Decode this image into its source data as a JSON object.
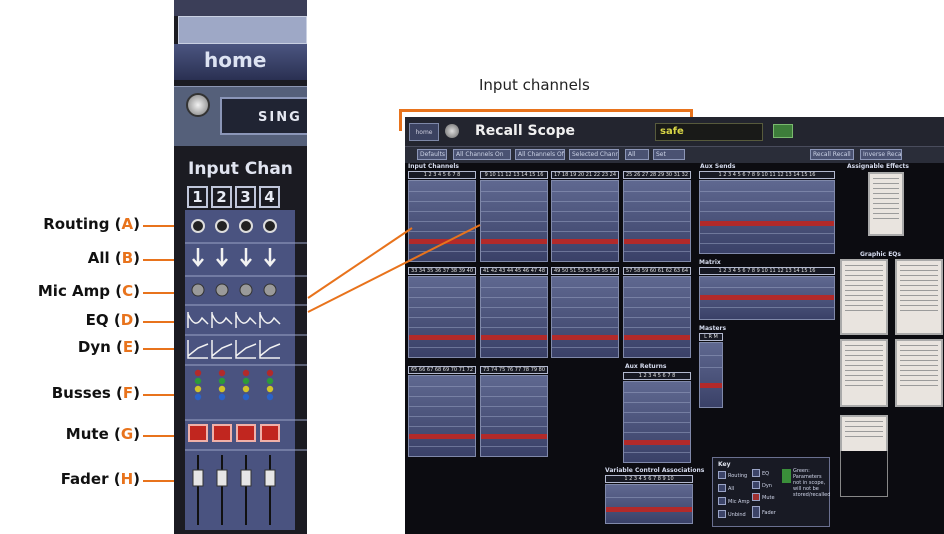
{
  "caption": "Input channels",
  "legend": [
    {
      "label": "Routing",
      "letter": "A"
    },
    {
      "label": "All",
      "letter": "B"
    },
    {
      "label": "Mic Amp",
      "letter": "C"
    },
    {
      "label": "EQ",
      "letter": "D"
    },
    {
      "label": "Dyn",
      "letter": "E"
    },
    {
      "label": "Busses",
      "letter": "F"
    },
    {
      "label": "Mute",
      "letter": "G"
    },
    {
      "label": "Fader",
      "letter": "H"
    }
  ],
  "zoom": {
    "home": "home",
    "selector": "SING",
    "title": "Input Chan",
    "channel_numbers": [
      "1",
      "2",
      "3",
      "4"
    ]
  },
  "window": {
    "home_button": "home",
    "title": "Recall Scope",
    "status": "safe",
    "toolbar": [
      "Defaults",
      "All Channels On",
      "All Channels Off",
      "Selected Channels",
      "All",
      "Set",
      "Recall Recall",
      "Inverse Recall"
    ],
    "sections": {
      "input_channels": "Input Channels",
      "aux_sends": "Aux Sends",
      "assignable_effects": "Assignable Effects",
      "matrix": "Matrix",
      "graphic_eqs": "Graphic EQs",
      "masters": "Masters",
      "aux_returns": "Aux Returns",
      "vca": "Variable Control Associations"
    },
    "input_rows": [
      [
        "1 2 3 4 5 6 7 8",
        "9 10 11 12 13 14 15 16",
        "17 18 19 20 21 22 23 24",
        "25 26 27 28 29 30 31 32"
      ],
      [
        "33 34 35 36 37 38 39 40",
        "41 42 43 44 45 46 47 48",
        "49 50 51 52 53 54 55 56",
        "57 58 59 60 61 62 63 64"
      ],
      [
        "65 66 67 68 69 70 71 72",
        "73 74 75 76 77 78 79 80"
      ]
    ],
    "aux_sends_numbers": "1 2 3 4 5 6 7 8 9 10 11 12 13 14 15 16",
    "matrix_numbers": "1 2 3 4 5 6 7 8 9 10 11 12 13 14 15 16",
    "masters_numbers": "L R M",
    "aux_returns_numbers": "1 2 3 4 5 6 7 8",
    "vca_numbers": "1 2 3 4 5 6 7 8 9 10",
    "key": {
      "title": "Key",
      "items": [
        "Routing",
        "All",
        "Mic Amp",
        "Unbind",
        "EQ",
        "Dyn",
        "Mute",
        "Fader"
      ],
      "note": "Green: Parameters not in scope, will not be stored/recalled"
    }
  }
}
